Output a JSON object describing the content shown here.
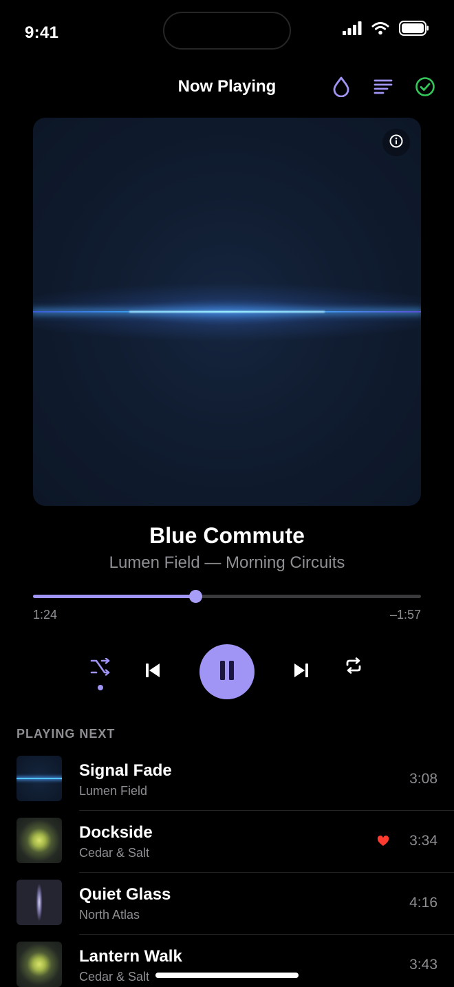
{
  "status": {
    "time": "9:41",
    "icons": [
      "signal-icon",
      "wifi-icon",
      "battery-icon"
    ]
  },
  "header": {
    "title": "Now Playing",
    "actions": [
      "drop-icon",
      "queue-list-icon",
      "check-circle-icon"
    ],
    "colors": {
      "accent": "#a095f5",
      "check": "#34c759"
    }
  },
  "now_playing": {
    "title": "Blue Commute",
    "subtitle": "Lumen Field — Morning Circuits",
    "elapsed": "1:24",
    "remaining": "–1:57",
    "progress_fraction": 0.418
  },
  "controls": {
    "shuffle_active": true,
    "playing": true
  },
  "queue": {
    "label": "PLAYING NEXT",
    "items": [
      {
        "title": "Signal Fade",
        "artist": "Lumen Field",
        "duration": "3:08",
        "art": "signal",
        "liked": false
      },
      {
        "title": "Dockside",
        "artist": "Cedar & Salt",
        "duration": "3:34",
        "art": "bloom",
        "liked": true
      },
      {
        "title": "Quiet Glass",
        "artist": "North Atlas",
        "duration": "4:16",
        "art": "glass",
        "liked": false
      },
      {
        "title": "Lantern Walk",
        "artist": "Cedar & Salt",
        "duration": "3:43",
        "art": "bloom",
        "liked": false
      }
    ]
  }
}
